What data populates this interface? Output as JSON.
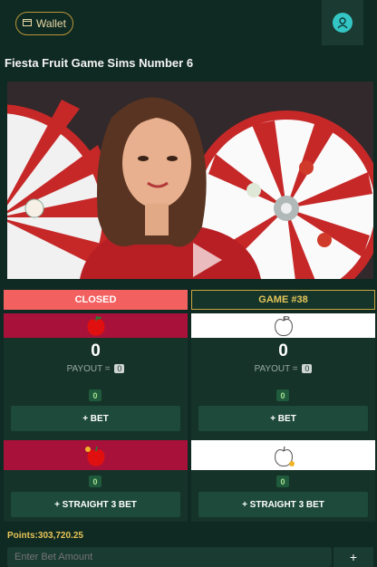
{
  "header": {
    "wallet_label": "Wallet"
  },
  "page_title": "Fiesta Fruit Game Sims Number 6",
  "status": {
    "closed_label": "CLOSED",
    "game_label": "GAME #38"
  },
  "left_panel": {
    "amount": "0",
    "payout_label": "PAYOUT =",
    "payout_value": "0",
    "bet_count": "0",
    "bet_label": "+ BET",
    "straight_count": "0",
    "straight_label": "+ STRAIGHT 3 BET"
  },
  "right_panel": {
    "amount": "0",
    "payout_label": "PAYOUT =",
    "payout_value": "0",
    "bet_count": "0",
    "bet_label": "+ BET",
    "straight_count": "0",
    "straight_label": "+ STRAIGHT 3 BET"
  },
  "points_label": "Points:303,720.25",
  "bet_input": {
    "placeholder": "Enter Bet Amount"
  },
  "colors": {
    "red_bar": "#a8123a",
    "closed": "#f26060",
    "gold": "#c9a63f"
  }
}
